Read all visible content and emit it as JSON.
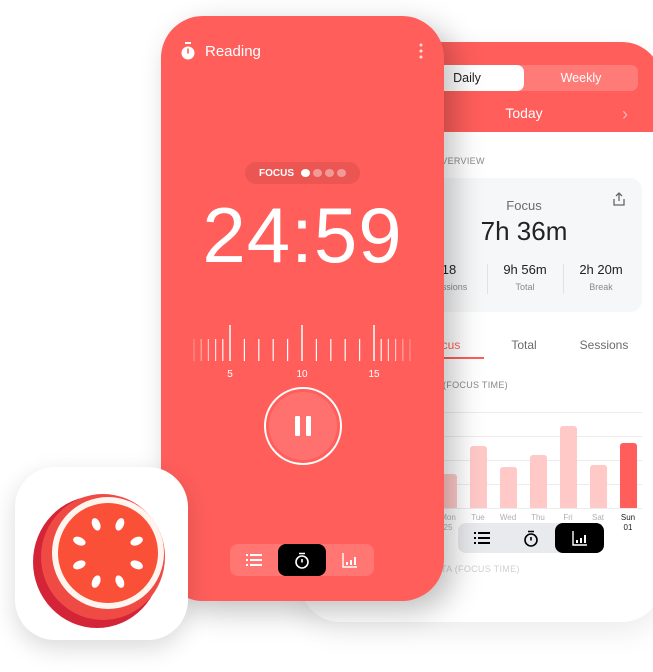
{
  "timer": {
    "task_name": "Reading",
    "mode_label": "FOCUS",
    "sessions_done": 1,
    "sessions_total": 4,
    "time_remaining": "24:59",
    "ruler_labels": [
      "5",
      "10",
      "15"
    ],
    "state": "running",
    "nav": [
      {
        "icon": "list-icon"
      },
      {
        "icon": "timer-icon",
        "active": true
      },
      {
        "icon": "chart-icon"
      }
    ]
  },
  "stats": {
    "segments": [
      "Daily",
      "Weekly"
    ],
    "selected_segment": "Daily",
    "period": "Today",
    "overview_label": "OVERVIEW",
    "focus_label": "Focus",
    "focus_value": "7h 36m",
    "sessions": {
      "value": "18",
      "label": "Sessions"
    },
    "total": {
      "value": "9h 56m",
      "label": "Total"
    },
    "break": {
      "value": "2h 20m",
      "label": "Break"
    },
    "tabs": [
      "Focus",
      "Total",
      "Sessions"
    ],
    "selected_tab": "Focus",
    "chart_title": "(FOCUS TIME)",
    "footer_label": "TA (FOCUS TIME)",
    "nav": [
      {
        "icon": "list-icon"
      },
      {
        "icon": "timer-icon"
      },
      {
        "icon": "chart-icon",
        "active": true
      }
    ]
  },
  "chart_data": {
    "type": "bar",
    "categories": [
      "Mon",
      "Tue",
      "Wed",
      "Thu",
      "Fri",
      "Sat",
      "Sun"
    ],
    "sublabels": [
      "25",
      "",
      "",
      "",
      "",
      "30",
      "01"
    ],
    "values": [
      1.4,
      2.6,
      1.7,
      2.2,
      3.4,
      1.8,
      2.7
    ],
    "highlighted": "Sun",
    "grid": true,
    "colors": {
      "bar": "#FFC9C8",
      "current": "#FF5E5B"
    }
  },
  "colors": {
    "accent": "#FF5E5B",
    "icon_red": "#FA5038",
    "icon_dark": "#D42438"
  }
}
